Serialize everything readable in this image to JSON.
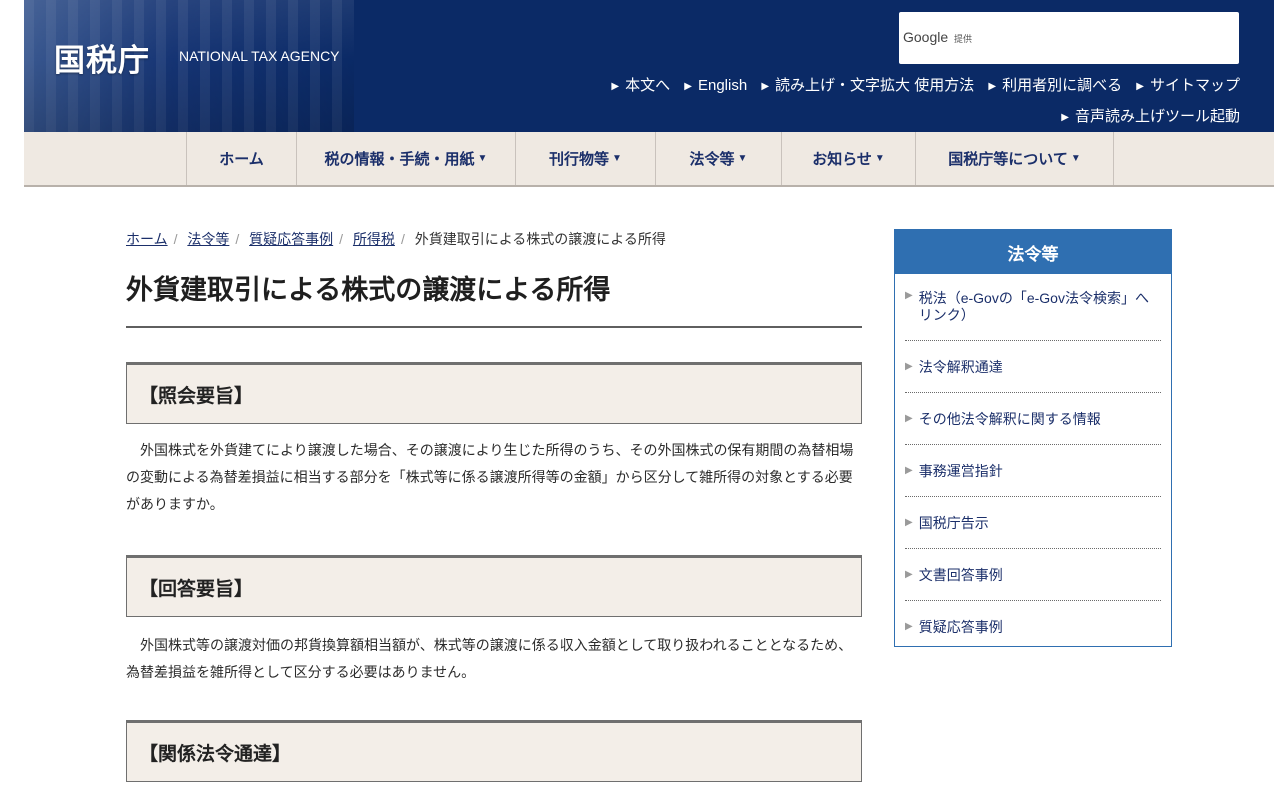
{
  "header": {
    "logo_title": "国税庁",
    "logo_subtitle": "NATIONAL TAX AGENCY",
    "search_brand": "Google",
    "search_provided": "提供",
    "utility_links": [
      "本文へ",
      "English",
      "読み上げ・文字拡大 使用方法",
      "利用者別に調べる",
      "サイトマップ"
    ],
    "voice_tool": "音声読み上げツール起動"
  },
  "gnav": {
    "items": [
      "ホーム",
      "税の情報・手続・用紙",
      "刊行物等",
      "法令等",
      "お知らせ",
      "国税庁等について"
    ],
    "caret": "▼"
  },
  "breadcrumb": [
    "ホーム",
    "法令等",
    "質疑応答事例",
    "所得税",
    "外貨建取引による株式の譲渡による所得"
  ],
  "page": {
    "title": "外貨建取引による株式の譲渡による所得",
    "sections": [
      {
        "heading": "【照会要旨】",
        "text": "外国株式を外貨建てにより譲渡した場合、その譲渡により生じた所得のうち、その外国株式の保有期間の為替相場の変動による為替差損益に相当する部分を「株式等に係る譲渡所得等の金額」から区分して雑所得の対象とする必要がありますか。"
      },
      {
        "heading": "【回答要旨】",
        "text": "外国株式等の譲渡対価の邦貨換算額相当額が、株式等の譲渡に係る収入金額として取り扱われることとなるため、為替差損益を雑所得として区分する必要はありません。"
      },
      {
        "heading": "【関係法令通達】",
        "text": ""
      }
    ]
  },
  "sidebar": {
    "heading": "法令等",
    "items": [
      "税法（e-Govの「e-Gov法令検索」へリンク）",
      "法令解釈通達",
      "その他法令解釈に関する情報",
      "事務運営指針",
      "国税庁告示",
      "文書回答事例",
      "質疑応答事例"
    ]
  },
  "colors": {
    "header_bg": "#0b2a66",
    "nav_bg": "#efe9e2",
    "link": "#1b2f6a",
    "sidebar_accent": "#2f6fb1"
  }
}
